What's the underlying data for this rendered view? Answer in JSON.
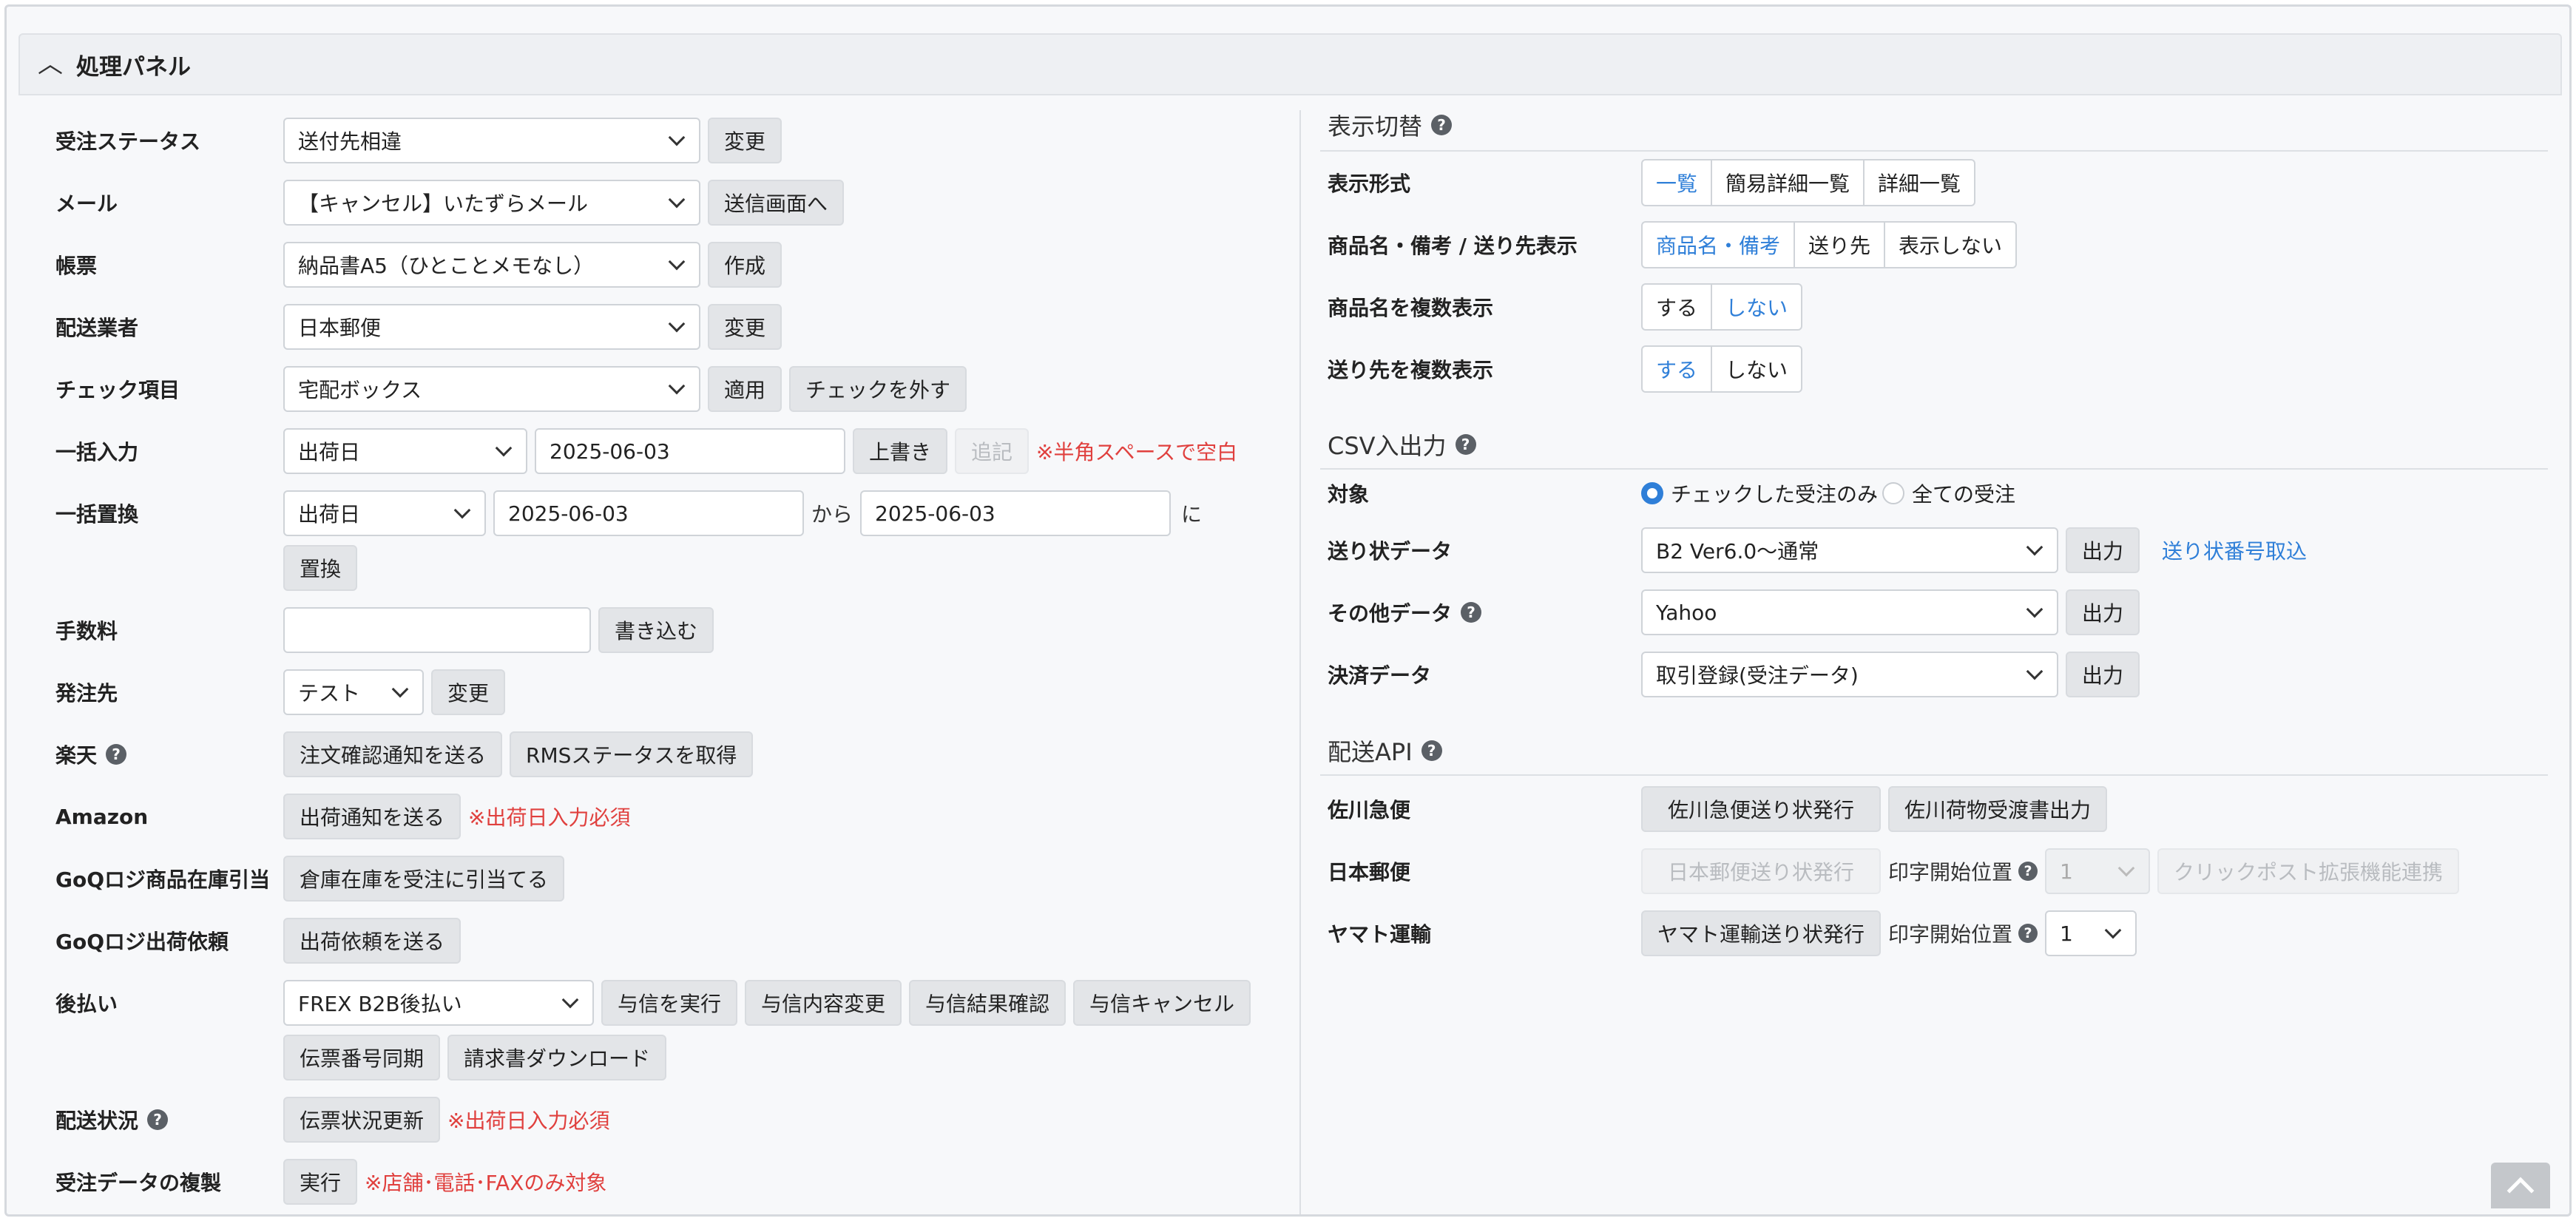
{
  "panel": {
    "title": "処理パネル"
  },
  "left": {
    "order_status": {
      "label": "受注ステータス",
      "value": "送付先相違",
      "button": "変更"
    },
    "mail": {
      "label": "メール",
      "value": "【キャンセル】いたずらメール",
      "button": "送信画面へ"
    },
    "form": {
      "label": "帳票",
      "value": "納品書A5（ひとことメモなし）",
      "button": "作成"
    },
    "carrier": {
      "label": "配送業者",
      "value": "日本郵便",
      "button": "変更"
    },
    "check": {
      "label": "チェック項目",
      "value": "宅配ボックス",
      "apply": "適用",
      "uncheck": "チェックを外す"
    },
    "bulk_input": {
      "label": "一括入力",
      "field": "出荷日",
      "date": "2025-06-03",
      "overwrite": "上書き",
      "append": "追記",
      "note": "※半角スペースで空白"
    },
    "bulk_replace": {
      "label": "一括置換",
      "field": "出荷日",
      "from_date": "2025-06-03",
      "from": "から",
      "to_date": "2025-06-03",
      "to": "に",
      "button": "置換"
    },
    "fee": {
      "label": "手数料",
      "value": "",
      "button": "書き込む"
    },
    "supplier": {
      "label": "発注先",
      "value": "テスト",
      "button": "変更"
    },
    "rakuten": {
      "label": "楽天",
      "help": "?",
      "notify": "注文確認通知を送る",
      "rms": "RMSステータスを取得"
    },
    "amazon": {
      "label": "Amazon",
      "notify": "出荷通知を送る",
      "note": "※出荷日入力必須"
    },
    "goq_stock": {
      "label": "GoQロジ商品在庫引当",
      "button": "倉庫在庫を受注に引当てる"
    },
    "goq_ship": {
      "label": "GoQロジ出荷依頼",
      "button": "出荷依頼を送る"
    },
    "deferred": {
      "label": "後払い",
      "value": "FREX B2B後払い",
      "buttons": [
        "与信を実行",
        "与信内容変更",
        "与信結果確認",
        "与信キャンセル"
      ],
      "buttons2": [
        "伝票番号同期",
        "請求書ダウンロード"
      ]
    },
    "delivery_status": {
      "label": "配送状況",
      "help": "?",
      "button": "伝票状況更新",
      "note": "※出荷日入力必須"
    },
    "duplicate": {
      "label": "受注データの複製",
      "button": "実行",
      "note": "※店舗･電話･FAXのみ対象"
    }
  },
  "right": {
    "display": {
      "title": "表示切替",
      "help": "?",
      "format": {
        "label": "表示形式",
        "options": [
          "一覧",
          "簡易詳細一覧",
          "詳細一覧"
        ],
        "active": 0
      },
      "product": {
        "label": "商品名・備考 / 送り先表示",
        "options": [
          "商品名・備考",
          "送り先",
          "表示しない"
        ],
        "active": 0
      },
      "multi_product": {
        "label": "商品名を複数表示",
        "options": [
          "する",
          "しない"
        ],
        "active": 1
      },
      "multi_dest": {
        "label": "送り先を複数表示",
        "options": [
          "する",
          "しない"
        ],
        "active": 0
      }
    },
    "csv": {
      "title": "CSV入出力",
      "help": "?",
      "target": {
        "label": "対象",
        "options": [
          "チェックした受注のみ",
          "全ての受注"
        ],
        "selected": 0
      },
      "shipping": {
        "label": "送り状データ",
        "value": "B2 Ver6.0～通常",
        "button": "出力",
        "link": "送り状番号取込"
      },
      "other": {
        "label": "その他データ",
        "help": "?",
        "value": "Yahoo",
        "button": "出力"
      },
      "payment": {
        "label": "決済データ",
        "value": "取引登録(受注データ)",
        "button": "出力"
      }
    },
    "api": {
      "title": "配送API",
      "help": "?",
      "sagawa": {
        "label": "佐川急便",
        "issue": "佐川急便送り状発行",
        "receipt": "佐川荷物受渡書出力"
      },
      "jp": {
        "label": "日本郵便",
        "issue": "日本郵便送り状発行",
        "pos_label": "印字開始位置",
        "pos": "1",
        "clickpost": "クリックポスト拡張機能連携"
      },
      "yamato": {
        "label": "ヤマト運輸",
        "issue": "ヤマト運輸送り状発行",
        "pos_label": "印字開始位置",
        "pos": "1"
      }
    }
  }
}
